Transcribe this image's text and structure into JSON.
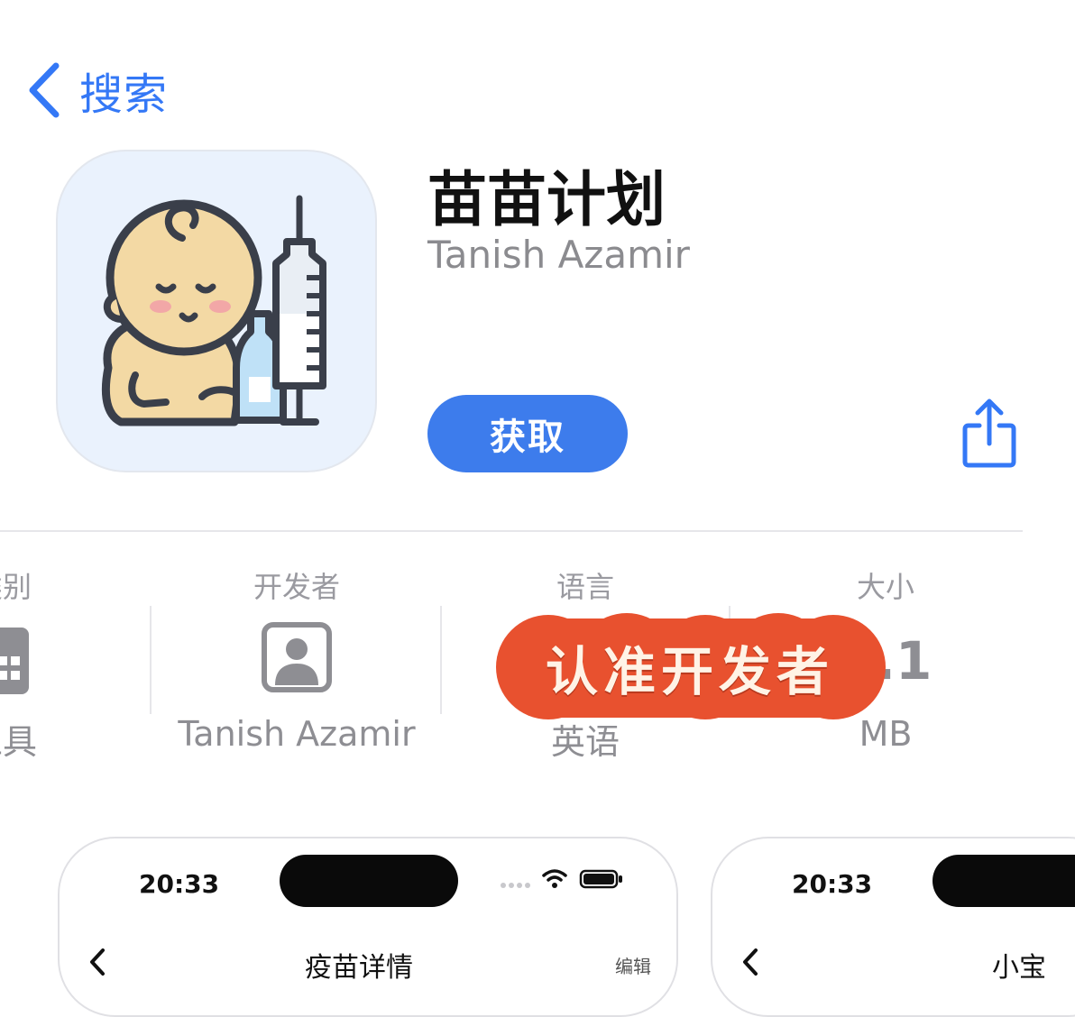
{
  "nav": {
    "back_label": "搜索"
  },
  "app": {
    "name": "苗苗计划",
    "developer": "Tanish Azamir",
    "get_label": "获取"
  },
  "info": {
    "category": {
      "head": "类别",
      "value": "工具"
    },
    "developer": {
      "head": "开发者",
      "value": "Tanish Azamir"
    },
    "language": {
      "head": "语言",
      "value": "英语"
    },
    "size": {
      "head": "大小",
      "value": "6.1",
      "unit": "MB"
    }
  },
  "sticker": {
    "text": "认准开发者"
  },
  "screenshots": [
    {
      "time": "20:33",
      "title": "疫苗详情",
      "action": "编辑"
    },
    {
      "time": "20:33",
      "title": "小宝"
    }
  ],
  "colors": {
    "accent": "#3478f6",
    "button": "#3d7cec",
    "sticker": "#e8512f"
  }
}
